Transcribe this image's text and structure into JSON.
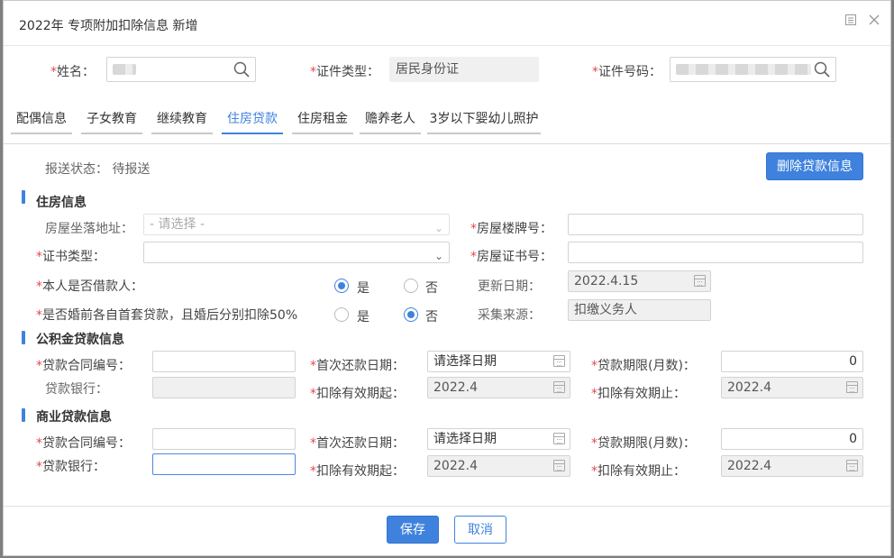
{
  "dialog": {
    "title": "2022年 专项附加扣除信息 新增"
  },
  "header_fields": {
    "name_label": "姓名：",
    "id_type_label": "证件类型：",
    "id_type_value": "居民身份证",
    "id_number_label": "证件号码："
  },
  "tabs": [
    {
      "label": "配偶信息"
    },
    {
      "label": "子女教育"
    },
    {
      "label": "继续教育"
    },
    {
      "label": "住房贷款"
    },
    {
      "label": "住房租金"
    },
    {
      "label": "赡养老人"
    },
    {
      "label": "3岁以下婴幼儿照护"
    }
  ],
  "status": {
    "text": "报送状态：  待报送",
    "delete_button": "删除贷款信息"
  },
  "housing": {
    "section_title": "住房信息",
    "address_label": "房屋坐落地址：",
    "address_placeholder": "- 请选择 -",
    "house_no_label": "房屋楼牌号：",
    "cert_type_label": "证书类型：",
    "cert_no_label": "房屋证书号：",
    "self_borrower_label": "本人是否借款人：",
    "yes": "是",
    "no": "否",
    "update_date_label": "更新日期：",
    "update_date_value": "2022.4.15",
    "premarital_label": "是否婚前各自首套贷款，且婚后分别扣除50%",
    "source_label": "采集来源：",
    "source_value": "扣缴义务人"
  },
  "fund_loan": {
    "section_title": "公积金贷款信息",
    "contract_label": "贷款合同编号：",
    "first_repay_label": "首次还款日期：",
    "first_repay_value": "请选择日期",
    "term_label": "贷款期限(月数)：",
    "term_value": "0",
    "bank_label": "贷款银行：",
    "start_label": "扣除有效期起：",
    "start_value": "2022.4",
    "end_label": "扣除有效期止：",
    "end_value": "2022.4"
  },
  "commercial_loan": {
    "section_title": "商业贷款信息",
    "contract_label": "贷款合同编号：",
    "first_repay_label": "首次还款日期：",
    "first_repay_value": "请选择日期",
    "term_label": "贷款期限(月数)：",
    "term_value": "0",
    "bank_label": "贷款银行：",
    "start_label": "扣除有效期起：",
    "start_value": "2022.4",
    "end_label": "扣除有效期止：",
    "end_value": "2022.4"
  },
  "footer": {
    "save": "保存",
    "cancel": "取消"
  },
  "required_mark": "*"
}
